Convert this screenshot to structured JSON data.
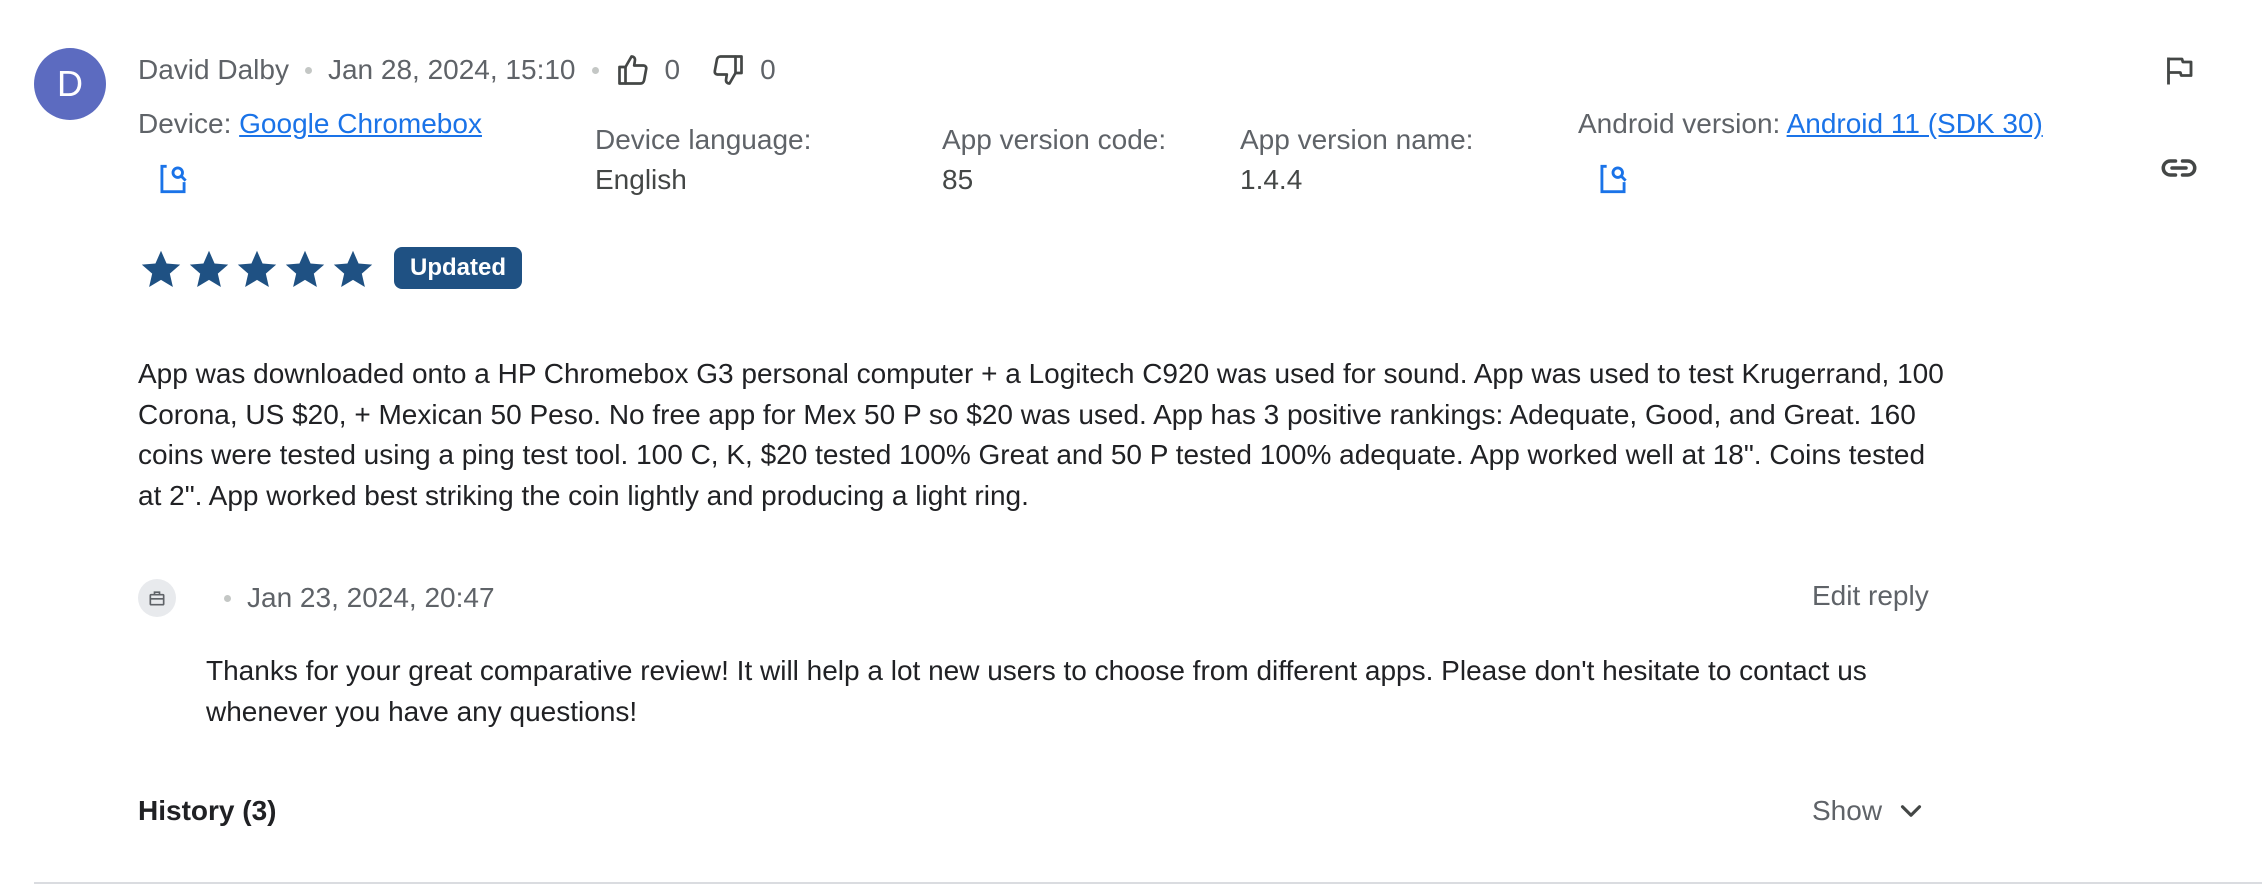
{
  "review": {
    "author": "David Dalby",
    "avatar_letter": "D",
    "date": "Jan 28, 2024, 15:10",
    "thumbs_up_count": "0",
    "thumbs_down_count": "0",
    "device_label": "Device:",
    "device_value": "Google Chromebox",
    "language_label": "Device language:",
    "language_value": "English",
    "version_code_label": "App version code:",
    "version_code_value": "85",
    "version_name_label": "App version name:",
    "version_name_value": "1.4.4",
    "android_label": "Android version:",
    "android_value": "Android 11 (SDK 30)",
    "rating": 5,
    "badge": "Updated",
    "text": "App was downloaded onto a HP Chromebox G3 personal computer + a Logitech C920 was used for sound. App was used to test Krugerrand, 100 Corona, US $20, + Mexican 50 Peso. No free app for Mex 50 P so $20 was used. App has 3 positive rankings: Adequate, Good, and Great. 160 coins were tested using a ping test tool. 100 C, K, $20 tested 100% Great and 50 P tested 100% adequate. App worked well at 18\". Coins tested at 2\". App worked best striking the coin lightly and producing a light ring."
  },
  "reply": {
    "date": "Jan 23, 2024, 20:47",
    "edit_label": "Edit reply",
    "text": "Thanks for your great comparative review! It will help a lot new users to choose from different apps. Please don't hesitate to contact us whenever you have any questions!"
  },
  "history": {
    "label": "History (3)",
    "show_label": "Show"
  },
  "colors": {
    "star": "#1f5183",
    "badge": "#1f5183",
    "link": "#1a73e8",
    "avatar": "#5c6bc0"
  }
}
